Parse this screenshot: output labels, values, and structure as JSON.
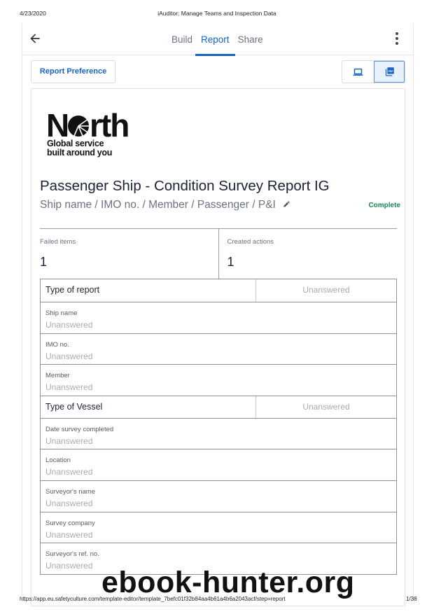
{
  "print": {
    "date": "4/23/2020",
    "title": "iAuditor: Manage Teams and Inspection Data",
    "url": "https://app.eu.safetyculture.com/template-editor/template_7befc01f32b84aa4b61a4b6a2043acf/step=report",
    "page": "1/38"
  },
  "topbar": {
    "back_icon": "arrow-left-icon",
    "tabs": [
      {
        "label": "Build",
        "active": false
      },
      {
        "label": "Report",
        "active": true
      },
      {
        "label": "Share",
        "active": false
      }
    ],
    "menu_icon": "more-vertical-icon"
  },
  "toolbar": {
    "report_preference_label": "Report Preference",
    "view_options": [
      {
        "icon": "laptop-icon",
        "selected": false
      },
      {
        "icon": "pdf-icon",
        "selected": true
      }
    ]
  },
  "report": {
    "logo": {
      "wordmark": "North",
      "tagline_line1": "Global service",
      "tagline_line2": "built around you"
    },
    "title": "Passenger Ship - Condition Survey Report IG",
    "subtitle": "Ship name / IMO no. / Member / Passenger / P&I",
    "status": "Complete",
    "status_color": "#168a52",
    "accent_color": "#1565c0",
    "stats": [
      {
        "label": "Failed items",
        "value": "1"
      },
      {
        "label": "Created actions",
        "value": "1"
      }
    ],
    "questions": [
      {
        "type": "header",
        "question": "Type of report",
        "answer": "Unanswered"
      },
      {
        "type": "field",
        "question": "Ship name",
        "answer": "Unanswered"
      },
      {
        "type": "field",
        "question": "IMO no.",
        "answer": "Unanswered"
      },
      {
        "type": "field",
        "question": "Member",
        "answer": "Unanswered"
      },
      {
        "type": "header",
        "question": "Type of Vessel",
        "answer": "Unanswered"
      },
      {
        "type": "field",
        "question": "Date survey completed",
        "answer": "Unanswered"
      },
      {
        "type": "field",
        "question": "Location",
        "answer": "Unanswered"
      },
      {
        "type": "field",
        "question": "Surveyor's name",
        "answer": "Unanswered"
      },
      {
        "type": "field",
        "question": "Survey company",
        "answer": "Unanswered"
      },
      {
        "type": "field",
        "question": "Surveyor's ref. no.",
        "answer": "Unanswered"
      }
    ]
  },
  "watermark": "ebook-hunter.org"
}
